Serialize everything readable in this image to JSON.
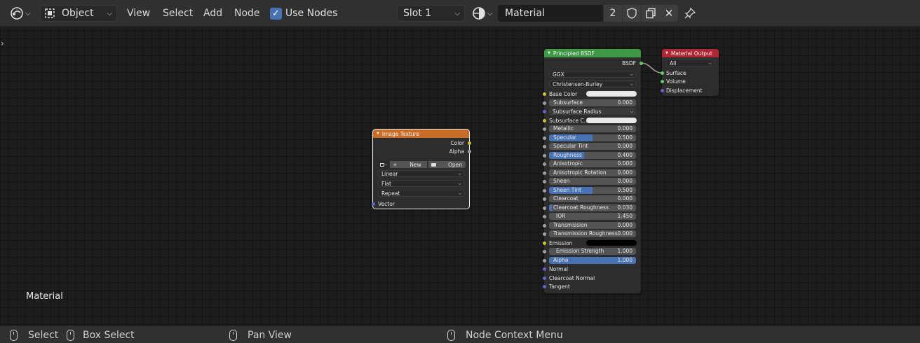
{
  "header": {
    "mode": "Object",
    "menus": [
      "View",
      "Select",
      "Add",
      "Node"
    ],
    "use_nodes_label": "Use Nodes",
    "slot": "Slot 1",
    "material_name": "Material",
    "user_count": "2"
  },
  "canvas": {
    "label": "Material"
  },
  "nodes": {
    "image_texture": {
      "title": "Image Texture",
      "out_color": "Color",
      "out_alpha": "Alpha",
      "new_label": "New",
      "open_label": "Open",
      "interpolation": "Linear",
      "projection": "Flat",
      "extension": "Repeat",
      "in_vector": "Vector"
    },
    "principled": {
      "title": "Principled BSDF",
      "out_bsdf": "BSDF",
      "distribution": "GGX",
      "subsurface_method": "Christensen-Burley",
      "base_color": "Base Color",
      "subsurface": {
        "label": "Subsurface",
        "value": "0.000"
      },
      "subsurface_radius": "Subsurface Radius",
      "subsurface_color": "Subsurface C...",
      "metallic": {
        "label": "Metallic",
        "value": "0.000"
      },
      "specular": {
        "label": "Specular",
        "value": "0.500"
      },
      "specular_tint": {
        "label": "Specular Tint",
        "value": "0.000"
      },
      "roughness": {
        "label": "Roughness",
        "value": "0.400"
      },
      "anisotropic": {
        "label": "Anisotropic",
        "value": "0.000"
      },
      "anisotropic_rotation": {
        "label": "Anisotropic Rotation",
        "value": "0.000"
      },
      "sheen": {
        "label": "Sheen",
        "value": "0.000"
      },
      "sheen_tint": {
        "label": "Sheen Tint",
        "value": "0.500"
      },
      "clearcoat": {
        "label": "Clearcoat",
        "value": "0.000"
      },
      "clearcoat_roughness": {
        "label": "Clearcoat Roughness",
        "value": "0.030"
      },
      "ior": {
        "label": "IOR",
        "value": "1.450"
      },
      "transmission": {
        "label": "Transmission",
        "value": "0.000"
      },
      "transmission_roughness": {
        "label": "Transmission Roughness",
        "value": "0.000"
      },
      "emission": "Emission",
      "emission_strength": {
        "label": "Emission Strength",
        "value": "1.000"
      },
      "alpha": {
        "label": "Alpha",
        "value": "1.000"
      },
      "normal": "Normal",
      "clearcoat_normal": "Clearcoat Normal",
      "tangent": "Tangent"
    },
    "material_output": {
      "title": "Material Output",
      "target": "All",
      "surface": "Surface",
      "volume": "Volume",
      "displacement": "Displacement"
    }
  },
  "status": {
    "select": "Select",
    "box_select": "Box Select",
    "pan_view": "Pan View",
    "context_menu": "Node Context Menu"
  },
  "colors": {
    "header_bg": "#303030",
    "canvas_bg": "#1d1d1d",
    "texture_header": "#c96c26",
    "shader_header": "#3c9a44",
    "output_header": "#b02632",
    "accent": "#4772b3"
  }
}
